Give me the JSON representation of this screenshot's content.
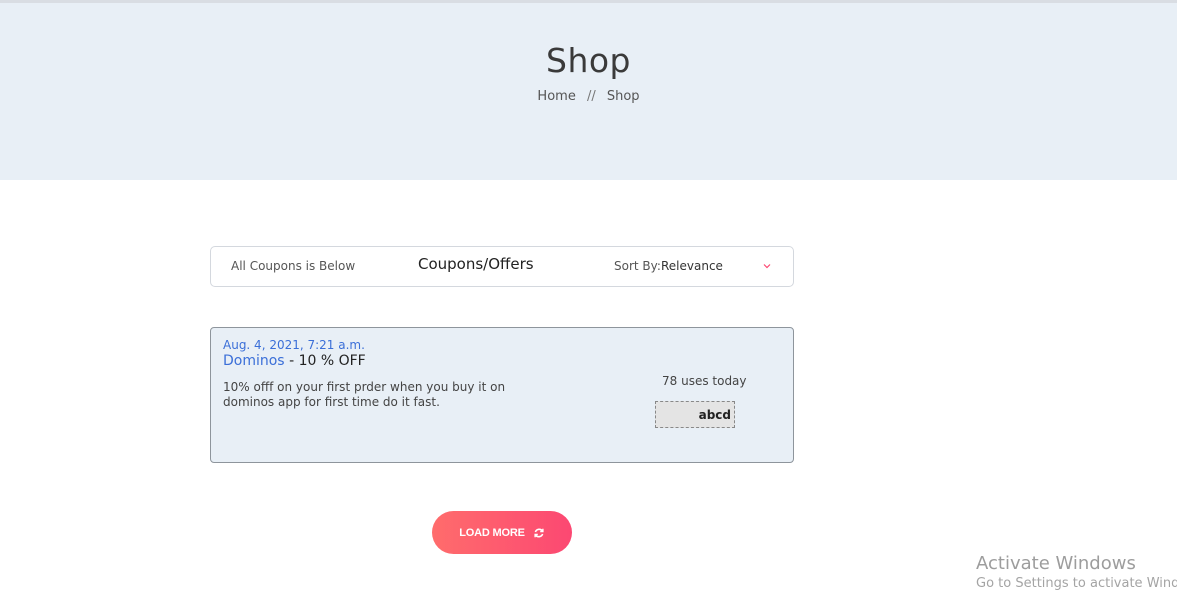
{
  "hero": {
    "title": "Shop",
    "breadcrumb": {
      "home": "Home",
      "separator": "//",
      "current": "Shop"
    }
  },
  "filter_bar": {
    "left_text": "All Coupons is Below",
    "title": "Coupons/Offers",
    "sort_label": "Sort By:",
    "sort_value": "Relevance",
    "chevron_icon": "chevron-down-icon",
    "accent_color": "#fc4872"
  },
  "coupons": [
    {
      "date": "Aug. 4, 2021, 7:21 a.m.",
      "brand": "Dominos",
      "dash": "-",
      "discount": "10 % OFF",
      "description": "10% offf on your first prder when you buy it on dominos app for first time do it fast.",
      "uses": "78 uses today",
      "code": "abcd"
    }
  ],
  "load_more": {
    "label": "LOAD MORE",
    "icon": "refresh-icon",
    "gradient": [
      "#ff6c6c",
      "#fc4872"
    ]
  },
  "watermark": {
    "title": "Activate Windows",
    "subtitle": "Go to Settings to activate Windows."
  },
  "colors": {
    "hero_bg": "#e8eff6",
    "link_blue": "#3b6fd8"
  }
}
